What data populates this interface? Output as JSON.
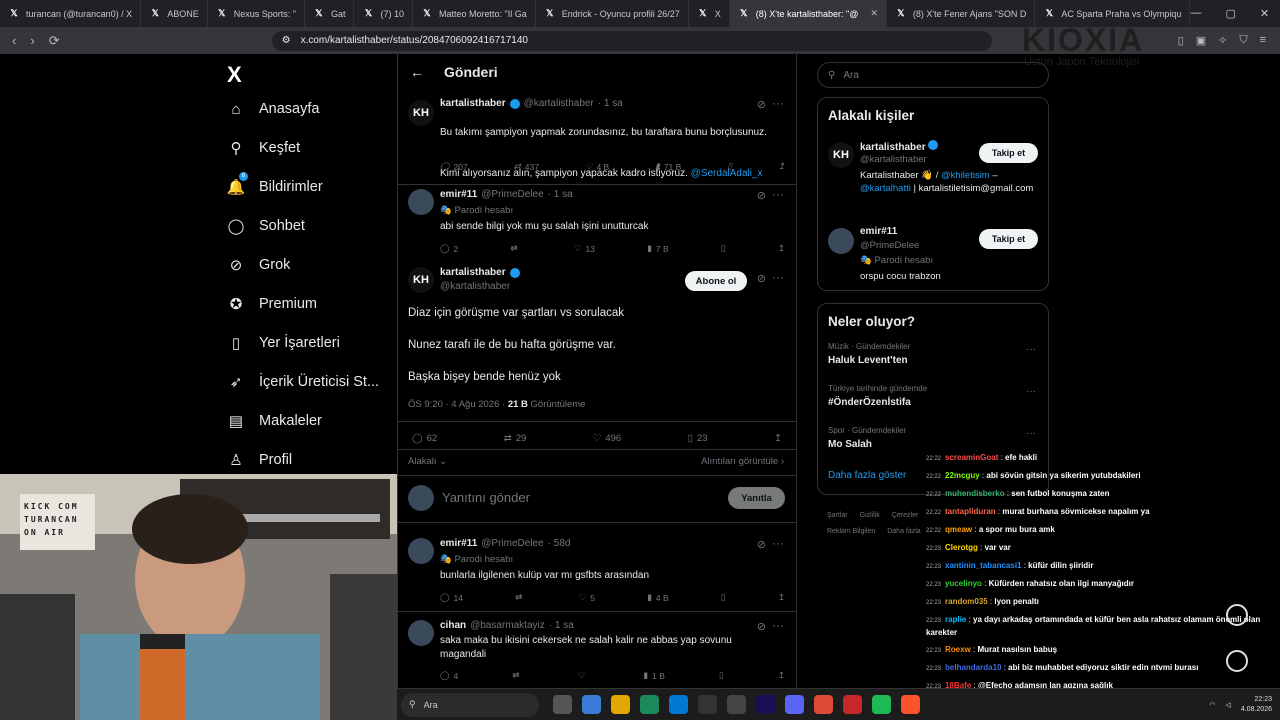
{
  "browser": {
    "tabs": [
      {
        "label": "turancan (@turancan0) / X",
        "active": false
      },
      {
        "label": "ABONE",
        "active": false
      },
      {
        "label": "Nexus Sports: \"",
        "active": false
      },
      {
        "label": "Gat",
        "active": false
      },
      {
        "label": "(7) 10",
        "active": false
      },
      {
        "label": "Matteo Moretto: \"Il Ga",
        "active": false
      },
      {
        "label": "Endrick - Oyuncu profili 26/27",
        "active": false
      },
      {
        "label": "X",
        "active": false
      },
      {
        "label": "(8) X'te kartalisthaber: \"@",
        "active": true
      },
      {
        "label": "(8) X'te Fener Ajans \"SON D",
        "active": false
      },
      {
        "label": "AC Sparta Praha vs Olympiqu",
        "active": false
      }
    ],
    "url": "x.com/kartalisthaber/status/2084706092416717140"
  },
  "overlay": {
    "kioxia": "KIOXIA",
    "kioxia_sub": "Üstün Japon Teknolojisi",
    "webcam_sign": [
      "KICK COM",
      "TURANCAN",
      "ON AIR"
    ]
  },
  "nav": {
    "logo": "X",
    "items": [
      {
        "label": "Anasayfa",
        "icon": "home-icon"
      },
      {
        "label": "Keşfet",
        "icon": "search-icon"
      },
      {
        "label": "Bildirimler",
        "icon": "bell-icon"
      },
      {
        "label": "Sohbet",
        "icon": "chat-icon"
      },
      {
        "label": "Grok",
        "icon": "grok-icon"
      },
      {
        "label": "Premium",
        "icon": "premium-icon"
      },
      {
        "label": "Yer İşaretleri",
        "icon": "bookmark-icon"
      },
      {
        "label": "İçerik Üreticisi St...",
        "icon": "rocket-icon"
      },
      {
        "label": "Makaleler",
        "icon": "article-icon"
      },
      {
        "label": "Profil",
        "icon": "person-icon"
      }
    ],
    "notif_badge": "6"
  },
  "main": {
    "title": "Gönderi",
    "parent_tweet": {
      "name": "kartalisthaber",
      "handle": "@kartalisthaber",
      "time": "· 1 sa",
      "text1": "Bu takımı şampiyon yapmak zorundasınız, bu taraftara bunu borçlusunuz.",
      "text2": "Kimi alıyorsanız alın, şampiyon yapacak kadro istiyoruz.",
      "mention": "@SerdalAdali_x",
      "replies": "207",
      "retweets": "437",
      "likes": "4 B",
      "views": "71 B"
    },
    "reply1": {
      "name": "emir#11",
      "handle": "@PrimeDelee",
      "time": "· 1 sa",
      "parody": "Parodi hesabı",
      "text": "abi sende bilgi yok mu şu salah işini unutturcak",
      "replies": "2",
      "retweets": "",
      "likes": "13",
      "views": "7 B"
    },
    "focus_tweet": {
      "name": "kartalisthaber",
      "handle": "@kartalisthaber",
      "follow_label": "Abone ol",
      "line1": "Diaz için görüşme var şartları vs sorulacak",
      "line2": "Nunez tarafı ile de bu hafta görüşme var.",
      "line3": "Başka bişey bende henüz yok",
      "meta": "ÖS 9:20 · 4 Ağu 2026 ·",
      "views_bold": "21 B",
      "views_label": "Görüntüleme",
      "replies": "62",
      "retweets": "29",
      "likes": "496",
      "bookmarks": "23",
      "relevant": "Alakalı",
      "quotes": "Alıntıları görüntüle"
    },
    "composer": {
      "placeholder": "Yanıtını gönder",
      "button": "Yanıtla"
    },
    "reply2": {
      "name": "emir#11",
      "handle": "@PrimeDelee",
      "time": "· 58d",
      "parody": "Parodi hesabı",
      "text": "bunlarla ilgilenen kulüp var mı gsfbts arasından",
      "replies": "14",
      "retweets": "",
      "likes": "5",
      "views": "4 B"
    },
    "reply3": {
      "name": "cihan",
      "handle": "@basarmaktayiz",
      "time": "· 1 sa",
      "text": "saka maka bu ikisini cekersek ne salah kalir ne abbas yap sovunu magandali",
      "replies": "4",
      "retweets": "",
      "likes": "",
      "views": "1 B"
    }
  },
  "right": {
    "search_placeholder": "Ara",
    "related_title": "Alakalı kişiler",
    "person1": {
      "name": "kartalisthaber",
      "handle": "@kartalisthaber",
      "bio_a": "Kartalisthaber 👋 /",
      "bio_m1": "@khiletisim",
      "bio_b": "–",
      "bio_m2": "@kartalhatti",
      "bio_c": "|",
      "bio_d": "kartalistiletisim@gmail.com",
      "button": "Takip et"
    },
    "person2": {
      "name": "emir#11",
      "handle": "@PrimeDelee",
      "parody": "Parodi hesabı",
      "bio": "orspu cocu trabzon",
      "button": "Takip et"
    },
    "trends_title": "Neler oluyor?",
    "trends": [
      {
        "category": "Müzik · Gündemdekiler",
        "name": "Haluk Levent'ten"
      },
      {
        "category": "Türkiye tarihinde gündemde",
        "name": "#ÖnderÖzenİstifa"
      },
      {
        "category": "Spor · Gündemdekiler",
        "name": "Mo Salah"
      }
    ],
    "show_more": "Daha fazla göster",
    "footer": [
      "Şartlar",
      "Gizlilik",
      "Çerezler",
      "Reklam Bilgileri",
      "Daha fazla"
    ]
  },
  "chat": [
    {
      "time": "22:22",
      "user": "screaminGoat",
      "color": "#ff4d4d",
      "msg": "efe hakli"
    },
    {
      "time": "22:22",
      "user": "22mcguy",
      "color": "#7CFC00",
      "msg": "abi sövün gitsin ya sikerim yutubdakileri"
    },
    {
      "time": "22:22",
      "user": "muhendisberko",
      "color": "#3cb371",
      "msg": "sen futbol konuşma zaten"
    },
    {
      "time": "22:22",
      "user": "tantapliduran",
      "color": "#ff6347",
      "msg": "murat burhana sövmicekse napalım ya"
    },
    {
      "time": "22:22",
      "user": "qmeaw",
      "color": "#ffa500",
      "msg": "a spor mu bura amk"
    },
    {
      "time": "22:23",
      "user": "Clerotgg",
      "color": "#ffd700",
      "msg": "var var"
    },
    {
      "time": "22:23",
      "user": "xantinin_tabancasi1",
      "color": "#1e90ff",
      "msg": "küfür dilin şiiridir"
    },
    {
      "time": "22:23",
      "user": "yucelinyo",
      "color": "#32cd32",
      "msg": "Küfürden rahatsız olan ilgi manyağıdır"
    },
    {
      "time": "22:23",
      "user": "random035",
      "color": "#daa520",
      "msg": "lyon penaltı"
    },
    {
      "time": "22:23",
      "user": "raplie",
      "color": "#00bfff",
      "msg": "ya dayı arkadaş ortamındada et küfür ben asla rahatsız olamam önemli olan karekter"
    },
    {
      "time": "22:23",
      "user": "Roexw",
      "color": "#ff8c00",
      "msg": "Murat nasılsın babuş"
    },
    {
      "time": "22:23",
      "user": "belhandarda10",
      "color": "#4169e1",
      "msg": "abi biz muhabbet ediyoruz siktir edin ntvmi burası"
    },
    {
      "time": "22:23",
      "user": "18Bafe",
      "color": "#ff3030",
      "msg": "@Efecho adamsın lan agzına sağlık"
    }
  ],
  "taskbar": {
    "search": "Ara",
    "time": "22:23",
    "date": "4.08.2026"
  }
}
